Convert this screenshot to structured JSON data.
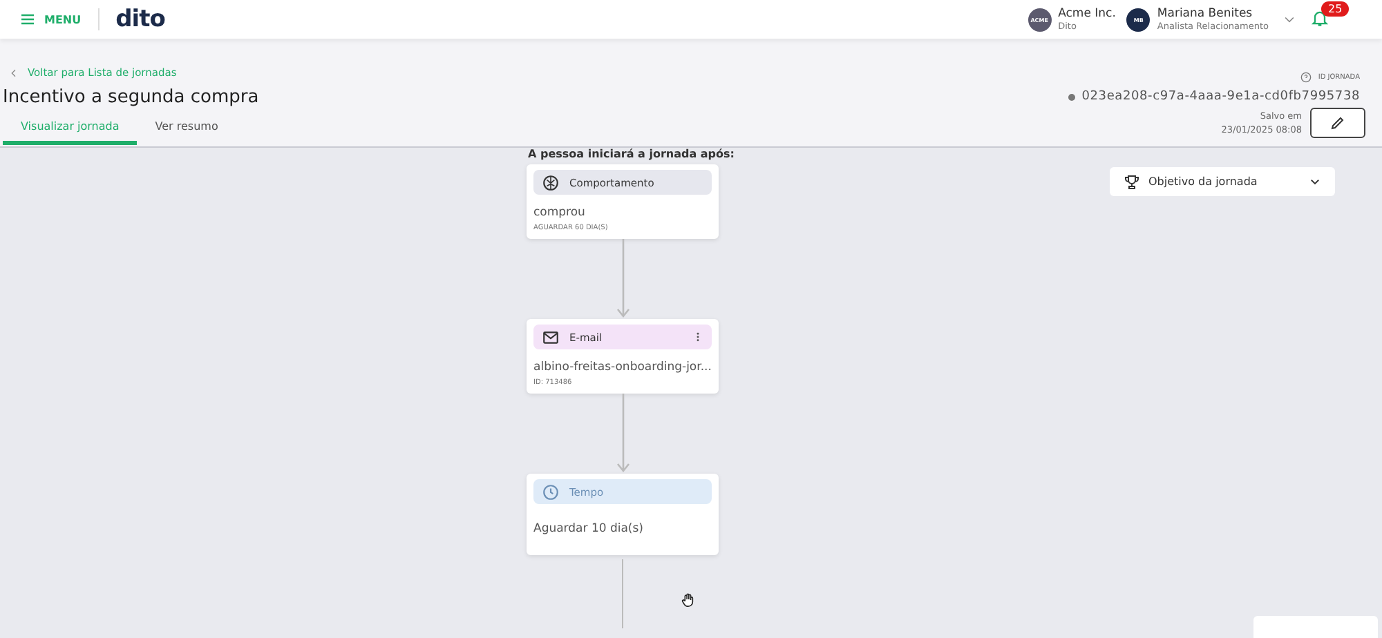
{
  "header": {
    "menu_label": "MENU",
    "logo": "dito",
    "company": {
      "avatar": "ACME",
      "name": "Acme Inc.",
      "sub": "Dito"
    },
    "user": {
      "avatar": "MB",
      "name": "Mariana Benites",
      "role": "Analista Relacionamento"
    },
    "notifications": "25"
  },
  "back_link": "Voltar para Lista de jornadas",
  "title": "Incentivo a segunda compra",
  "journey_id": {
    "label": "ID JORNADA",
    "value": "023ea208-c97a-4aaa-9e1a-cd0fb7995738"
  },
  "saved": {
    "label": "Salvo em",
    "date": "23/01/2025 08:08"
  },
  "tabs": [
    {
      "label": "Visualizar jornada",
      "selected": true
    },
    {
      "label": "Ver resumo",
      "selected": false
    }
  ],
  "canvas": {
    "start_label": "A pessoa iniciará a jornada após:",
    "goal_dropdown": "Objetivo da jornada",
    "nodes": [
      {
        "kind": "behavior",
        "title": "Comportamento",
        "text": "comprou",
        "note": "AGUARDAR 60 DIA(S)"
      },
      {
        "kind": "email",
        "title": "E-mail",
        "text": "albino-freitas-onboarding-jor...",
        "note": "ID: 713486"
      },
      {
        "kind": "time",
        "title": "Tempo",
        "text": "Aguardar 10 dia(s)"
      }
    ]
  }
}
